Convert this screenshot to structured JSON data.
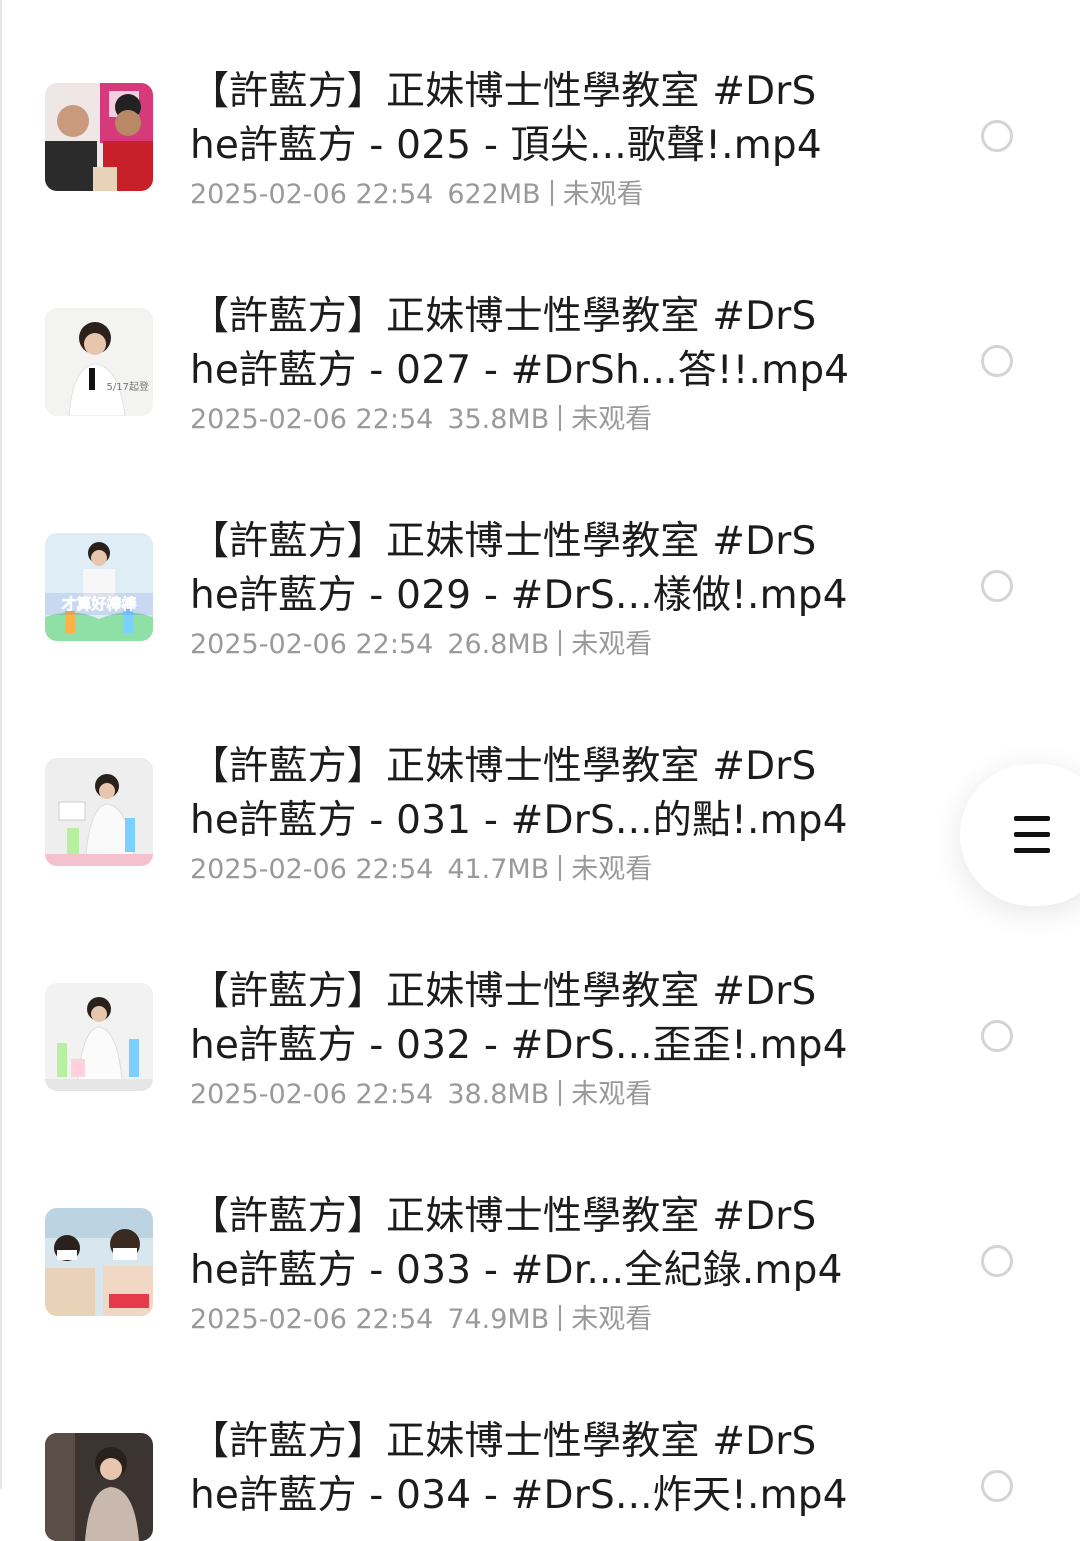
{
  "items": [
    {
      "title": "【許藍方】正妹博士性學教室 #DrS\nhe許藍方 - 025 - 頂尖...歌聲!.mp4",
      "date": "2025-02-06 22:54",
      "size": "622MB",
      "status": "未观看",
      "thumb_caption": ""
    },
    {
      "title": "【許藍方】正妹博士性學教室 #DrS\nhe許藍方 - 027 - #DrSh...答!!.mp4",
      "date": "2025-02-06 22:54",
      "size": "35.8MB",
      "status": "未观看",
      "thumb_caption": "5/17起登"
    },
    {
      "title": "【許藍方】正妹博士性學教室 #DrS\nhe許藍方 - 029 - #DrS...樣做!.mp4",
      "date": "2025-02-06 22:54",
      "size": "26.8MB",
      "status": "未观看",
      "thumb_caption": "才算好棒棒"
    },
    {
      "title": "【許藍方】正妹博士性學教室 #DrS\nhe許藍方 - 031 - #DrS...的點!.mp4",
      "date": "2025-02-06 22:54",
      "size": "41.7MB",
      "status": "未观看",
      "thumb_caption": ""
    },
    {
      "title": "【許藍方】正妹博士性學教室 #DrS\nhe許藍方 - 032 - #DrS...歪歪!.mp4",
      "date": "2025-02-06 22:54",
      "size": "38.8MB",
      "status": "未观看",
      "thumb_caption": ""
    },
    {
      "title": "【許藍方】正妹博士性學教室 #DrS\nhe許藍方 - 033 - #Dr...全紀錄.mp4",
      "date": "2025-02-06 22:54",
      "size": "74.9MB",
      "status": "未观看",
      "thumb_caption": ""
    },
    {
      "title": "【許藍方】正妹博士性學教室 #DrS\nhe許藍方 - 034 - #DrS...炸天!.mp4",
      "date": "",
      "size": "",
      "status": "",
      "thumb_caption": ""
    }
  ],
  "fab": {
    "icon": "menu-icon"
  },
  "colors": {
    "title": "#1c1c1c",
    "meta": "#9a9a9a",
    "radio": "#d4d4d4"
  }
}
